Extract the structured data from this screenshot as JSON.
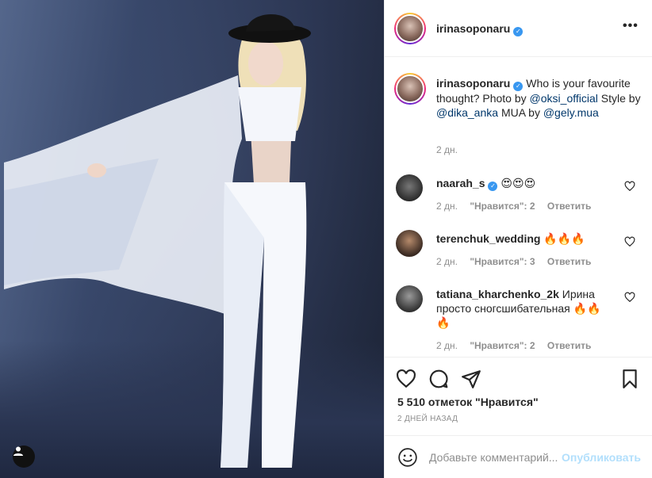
{
  "post": {
    "username": "irinasoponaru",
    "caption": {
      "username": "irinasoponaru",
      "text_1": "Who is your favourite thought? Photo by",
      "mention_1": "@oksi_official",
      "text_2": "Style by",
      "mention_2": "@dika_anka",
      "text_3": "MUA by",
      "mention_3": "@gely.mua",
      "time": "2 дн."
    },
    "comments": [
      {
        "username": "naarah_s",
        "verified": true,
        "text": "😍😍😍",
        "time": "2 дн.",
        "likes": "\"Нравится\": 2",
        "reply": "Ответить"
      },
      {
        "username": "terenchuk_wedding",
        "verified": false,
        "text": "🔥🔥🔥",
        "time": "2 дн.",
        "likes": "\"Нравится\": 3",
        "reply": "Ответить"
      },
      {
        "username": "tatiana_kharchenko_2k",
        "verified": false,
        "text": "Ирина просто сногсшибательная 🔥🔥🔥",
        "time": "2 дн.",
        "likes": "\"Нравится\": 2",
        "reply": "Ответить"
      }
    ],
    "likes_count": "5 510 отметок \"Нравится\"",
    "posted_ago": "2 ДНЕЙ НАЗАД",
    "comment_placeholder": "Добавьте комментарий...",
    "publish_label": "Опубликовать",
    "icons": [
      "heart-icon",
      "comment-icon",
      "share-icon",
      "bookmark-icon",
      "emoji-icon",
      "more-icon",
      "verified-icon",
      "user-tag-icon"
    ]
  },
  "colors": {
    "link": "#00376b",
    "verified": "#3897f0",
    "muted": "#8e8e8e",
    "publish_disabled": "#b2dffc"
  }
}
